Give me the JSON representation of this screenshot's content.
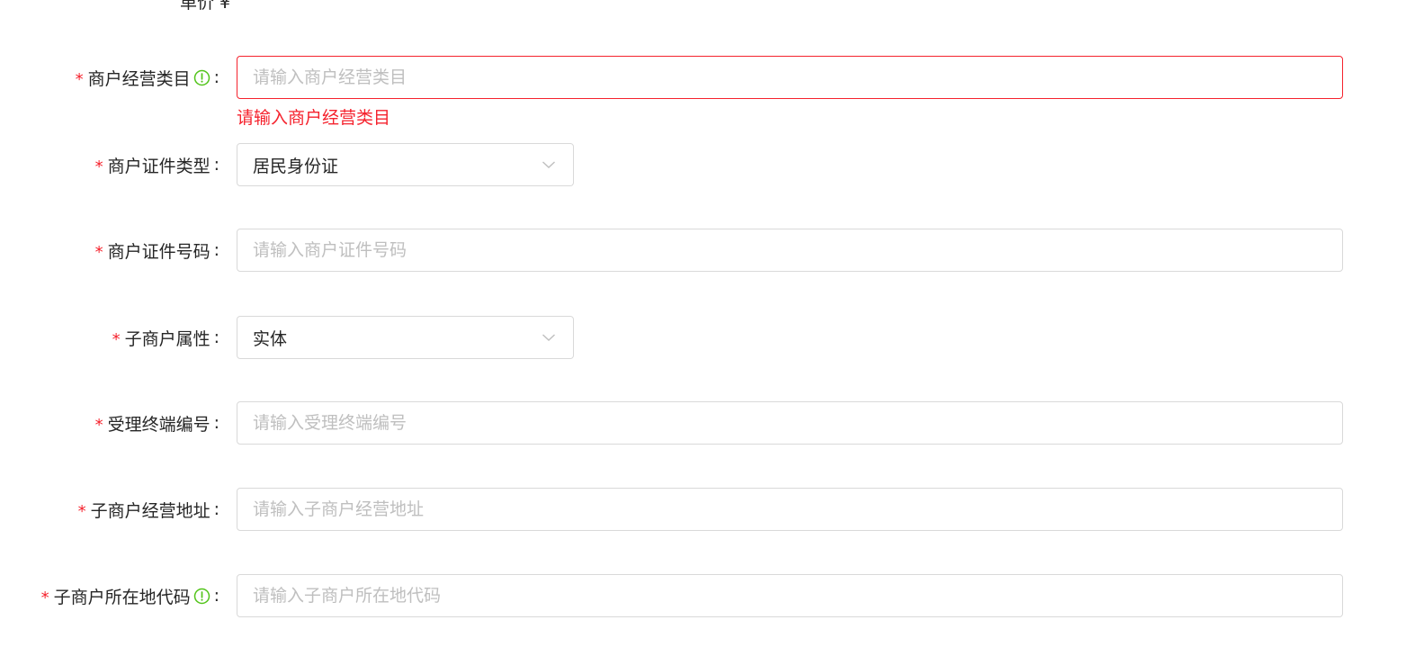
{
  "clipped_header": "单价          ¥",
  "fields": {
    "category": {
      "label": "商户经营类目",
      "colon": ":",
      "placeholder": "请输入商户经营类目",
      "value": "",
      "error": "请输入商户经营类目",
      "has_info_icon": true
    },
    "id_type": {
      "label": "商户证件类型",
      "colon": ":",
      "selected": "居民身份证"
    },
    "id_number": {
      "label": "商户证件号码",
      "colon": ":",
      "placeholder": "请输入商户证件号码",
      "value": ""
    },
    "sub_attr": {
      "label": "子商户属性",
      "colon": ":",
      "selected": "实体"
    },
    "terminal_no": {
      "label": "受理终端编号",
      "colon": ":",
      "placeholder": "请输入受理终端编号",
      "value": ""
    },
    "sub_address": {
      "label": "子商户经营地址",
      "colon": ":",
      "placeholder": "请输入子商户经营地址",
      "value": ""
    },
    "sub_region_code": {
      "label": "子商户所在地代码",
      "colon": ":",
      "placeholder": "请输入子商户所在地代码",
      "value": "",
      "has_info_icon": true
    }
  },
  "required_mark": "*",
  "icons": {
    "info": "info-circle-icon",
    "select_arrow": "chevron-down-icon"
  },
  "colors": {
    "required": "#f5222d",
    "error": "#f5222d",
    "info_icon": "#52c41a",
    "border": "#d9d9d9",
    "placeholder": "#bfbfbf",
    "text": "#262626"
  }
}
